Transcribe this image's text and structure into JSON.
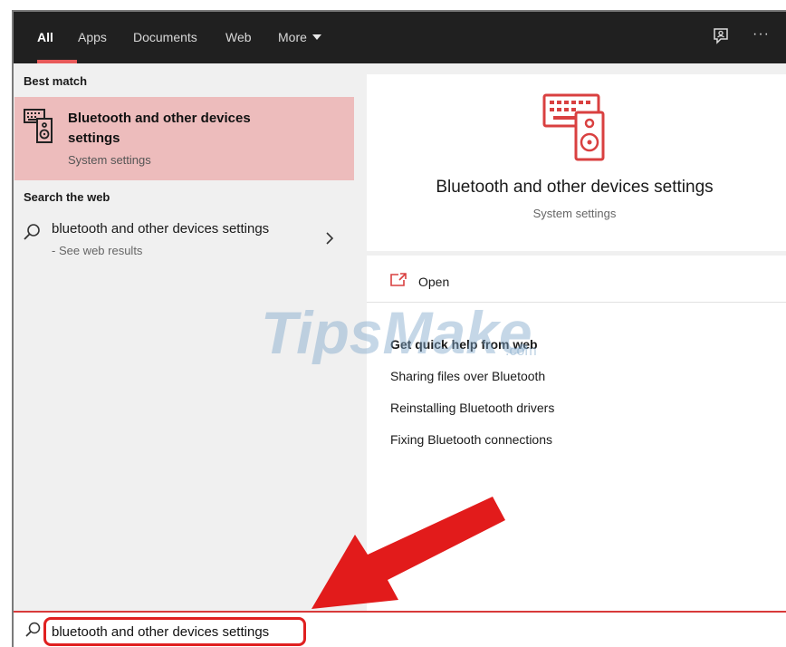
{
  "tabs": [
    {
      "label": "All",
      "active": true
    },
    {
      "label": "Apps",
      "active": false
    },
    {
      "label": "Documents",
      "active": false
    },
    {
      "label": "Web",
      "active": false
    },
    {
      "label": "More",
      "active": false
    }
  ],
  "toolbar": {
    "feedback_icon": "feedback-icon",
    "more_options": "···"
  },
  "left": {
    "best_match_header": "Best match",
    "best_match": {
      "title": "Bluetooth and other devices settings",
      "subtitle": "System settings",
      "icon": "devices-icon"
    },
    "search_web_header": "Search the web",
    "web_result": {
      "query": "bluetooth and other devices settings",
      "sub": "- See web results"
    }
  },
  "right": {
    "title": "Bluetooth and other devices settings",
    "subtitle": "System settings",
    "open_label": "Open",
    "help_title": "Get quick help from web",
    "help_links": [
      "Sharing files over Bluetooth",
      "Reinstalling Bluetooth drivers",
      "Fixing Bluetooth connections"
    ]
  },
  "watermark": {
    "text": "TipsMake",
    "suffix": ".com"
  },
  "search": {
    "value": "bluetooth and other devices settings"
  },
  "colors": {
    "accent": "#e85a5a",
    "highlight": "#edbcbc",
    "icon_red": "#d94040",
    "topbar": "#202020",
    "annotation_red": "#e02020"
  }
}
